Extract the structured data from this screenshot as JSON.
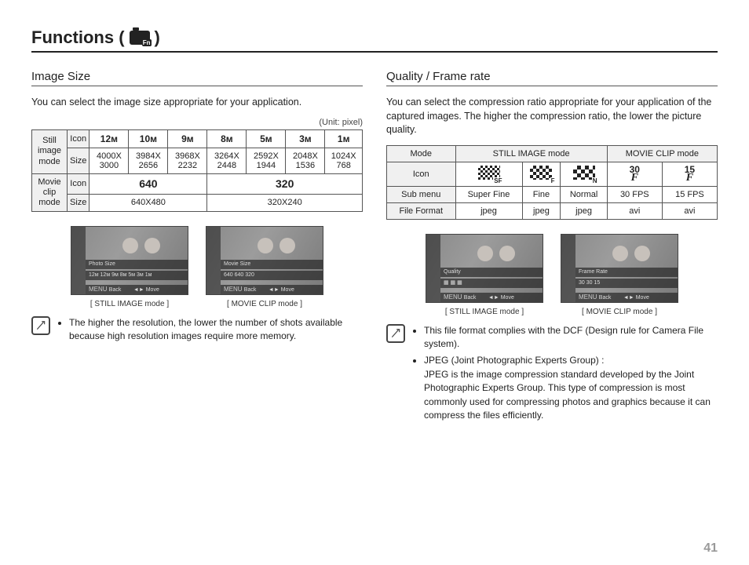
{
  "title_prefix": "Functions (",
  "title_suffix": ")",
  "page_number": "41",
  "left": {
    "heading": "Image Size",
    "intro": "You can select the image size appropriate for your application.",
    "unit": "(Unit: pixel)",
    "table": {
      "group_still": "Still image mode",
      "group_movie": "Movie clip mode",
      "row_icon": "Icon",
      "row_size": "Size",
      "still_icons": [
        "12ᴍ",
        "10ᴍ",
        "9ᴍ",
        "8ᴍ",
        "5ᴍ",
        "3ᴍ",
        "1ᴍ"
      ],
      "still_sizes": [
        "4000X 3000",
        "3984X 2656",
        "3968X 2232",
        "3264X 2448",
        "2592X 1944",
        "2048X 1536",
        "1024X 768"
      ],
      "movie_icons": [
        "640",
        "320"
      ],
      "movie_sizes": [
        "640X480",
        "320X240"
      ]
    },
    "screens": {
      "strip1_a": "Photo Size",
      "strip2_a": "12ᴍ 12ᴍ 9ᴍ 8ᴍ 5ᴍ 3ᴍ 1ᴍ",
      "strip1_b": "Movie Size",
      "strip2_b": "640 640 320",
      "back": "Back",
      "move": "Move",
      "cap_a": "[ STILL IMAGE mode ]",
      "cap_b": "[ MOVIE CLIP mode ]"
    },
    "note1": "The higher the resolution, the lower the number of shots available because high resolution images require more memory."
  },
  "right": {
    "heading": "Quality / Frame rate",
    "intro": "You can select the compression ratio appropriate for your application of the captured images. The higher the compression ratio, the lower the picture quality.",
    "table": {
      "h_mode": "Mode",
      "h_still": "STILL IMAGE mode",
      "h_movie": "MOVIE CLIP mode",
      "r_icon": "Icon",
      "icon_subs": [
        "SF",
        "F",
        "N"
      ],
      "fps": [
        "30",
        "15"
      ],
      "r_sub": "Sub menu",
      "subs": [
        "Super Fine",
        "Fine",
        "Normal",
        "30 FPS",
        "15 FPS"
      ],
      "r_fmt": "File Format",
      "fmts": [
        "jpeg",
        "jpeg",
        "jpeg",
        "avi",
        "avi"
      ]
    },
    "screens": {
      "strip1_a": "Quality",
      "strip1_b": "Frame Rate",
      "back": "Back",
      "move": "Move",
      "cap_a": "[ STILL IMAGE mode ]",
      "cap_b": "[ MOVIE CLIP mode ]"
    },
    "note1": "This file format complies with the DCF (Design rule for Camera File system).",
    "note2a": "JPEG (Joint Photographic Experts Group) :",
    "note2b": "JPEG is the image compression standard developed by the Joint Photographic Experts Group. This type of compression is most commonly used for compressing photos and graphics because it can compress the files efficiently."
  }
}
